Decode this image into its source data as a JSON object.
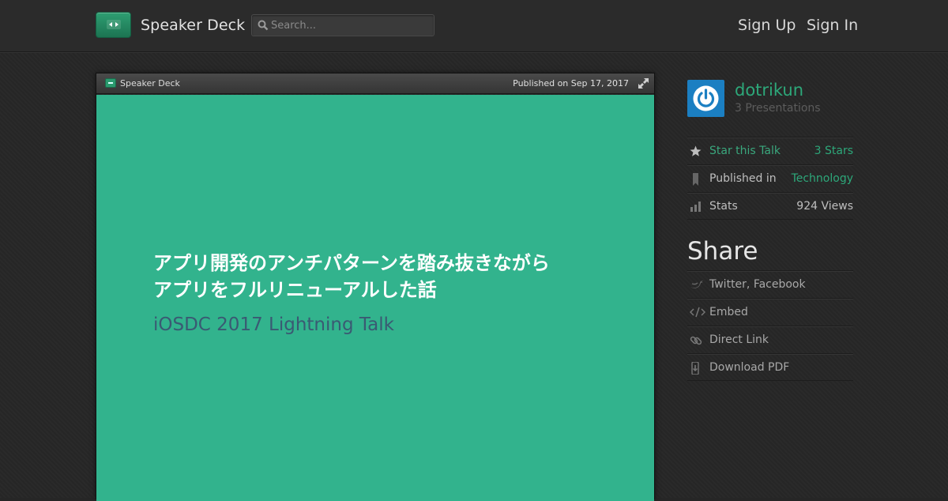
{
  "header": {
    "brand": "Speaker Deck",
    "search_placeholder": "Search...",
    "sign_up": "Sign Up",
    "sign_in": "Sign In"
  },
  "player": {
    "brand": "Speaker Deck",
    "published": "Published on Sep 17, 2017",
    "slide": {
      "title_line1": "アプリ開発のアンチパターンを踏み抜きながら",
      "title_line2": "アプリをフルリニューアルした話",
      "subtitle": "iOSDC 2017 Lightning Talk",
      "background": "#32b38d"
    }
  },
  "sidebar": {
    "author": "dotrikun",
    "presentations": "3 Presentations",
    "rows": [
      {
        "icon": "star-icon",
        "label": "Star this Talk",
        "value": "3 Stars"
      },
      {
        "icon": "bookmark-icon",
        "label": "Published in",
        "value": "Technology"
      },
      {
        "icon": "bar-chart-icon",
        "label": "Stats",
        "value": "924 Views"
      }
    ],
    "share_title": "Share",
    "share": [
      {
        "icon": "bird-icon",
        "label": "Twitter, Facebook"
      },
      {
        "icon": "code-icon",
        "label": "Embed"
      },
      {
        "icon": "link-icon",
        "label": "Direct Link"
      },
      {
        "icon": "download-icon",
        "label": "Download PDF"
      }
    ]
  },
  "colors": {
    "accent": "#2da87a",
    "avatar": "#1b7fc2"
  }
}
